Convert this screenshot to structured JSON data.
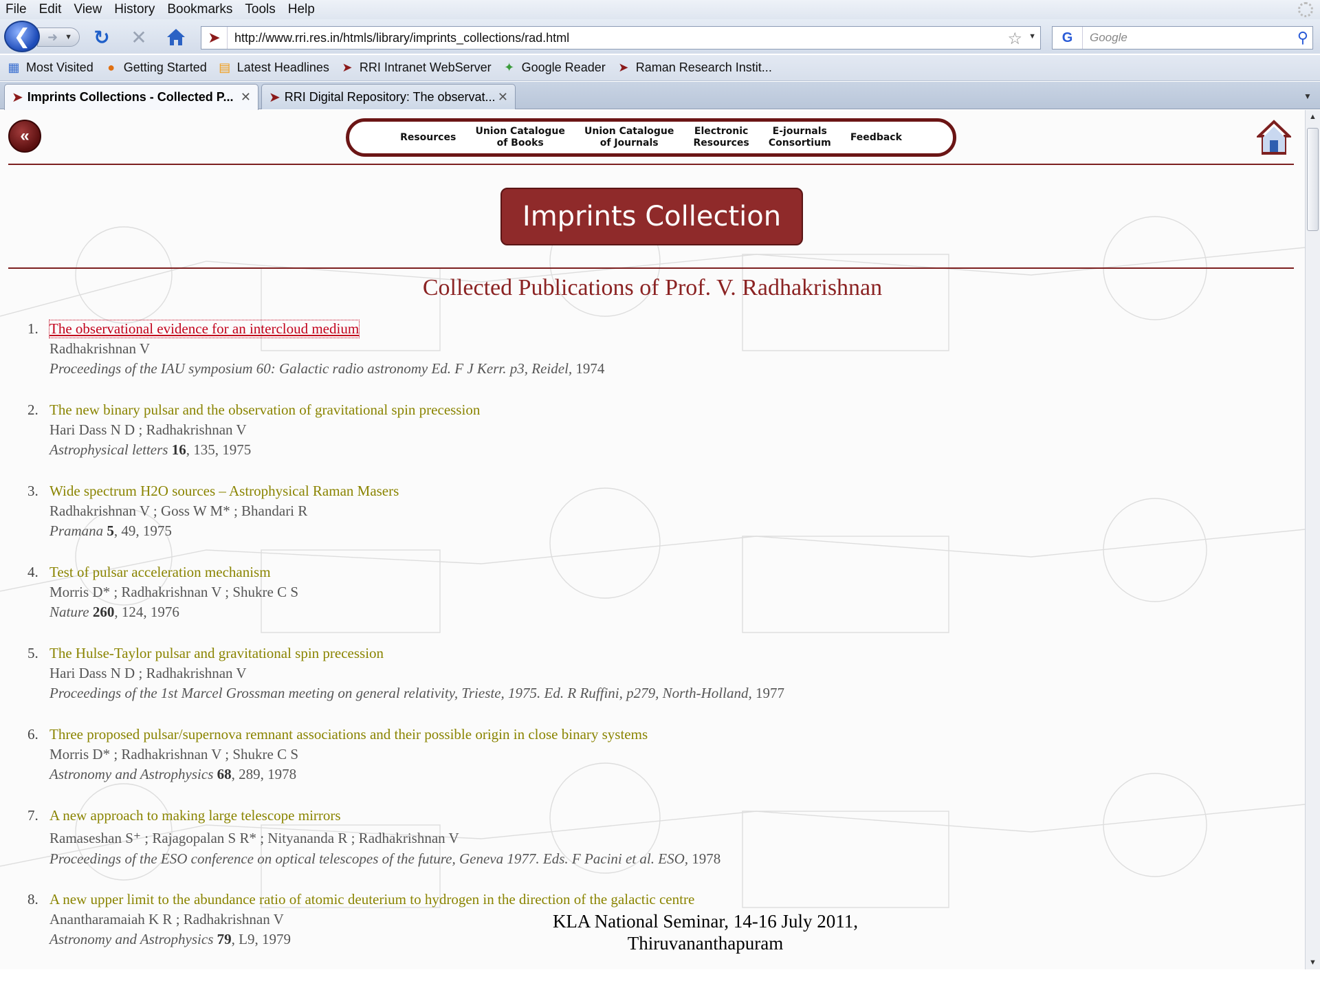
{
  "menubar": {
    "items": [
      "File",
      "Edit",
      "View",
      "History",
      "Bookmarks",
      "Tools",
      "Help"
    ]
  },
  "navbar": {
    "url": "http://www.rri.res.in/htmls/library/imprints_collections/rad.html",
    "search_placeholder": "Google"
  },
  "bookmarks": [
    {
      "label": "Most Visited",
      "icon": "most-visited-icon"
    },
    {
      "label": "Getting Started",
      "icon": "firefox-icon"
    },
    {
      "label": "Latest Headlines",
      "icon": "rss-icon"
    },
    {
      "label": "RRI Intranet WebServer",
      "icon": "rri-logo-icon"
    },
    {
      "label": "Google Reader",
      "icon": "google-reader-icon"
    },
    {
      "label": "Raman Research Instit...",
      "icon": "rri-logo-icon"
    }
  ],
  "tabs": [
    {
      "label": "Imprints Collections - Collected P...",
      "active": true
    },
    {
      "label": "RRI Digital Repository: The observat...",
      "active": false
    }
  ],
  "site_nav": {
    "resources": "Resources",
    "union_books_1": "Union Catalogue",
    "union_books_2": "of Books",
    "union_journals_1": "Union Catalogue",
    "union_journals_2": "of Journals",
    "electronic_1": "Electronic",
    "electronic_2": "Resources",
    "ejournals_1": "E-journals",
    "ejournals_2": "Consortium",
    "feedback": "Feedback"
  },
  "page": {
    "banner": "Imprints Collection",
    "heading": "Collected Publications of Prof. V. Radhakrishnan"
  },
  "publications": [
    {
      "num": "1.",
      "title": "The observational evidence for an intercloud medium",
      "authors": "Radhakrishnan V",
      "journal": "Proceedings of the IAU symposium 60: Galactic radio astronomy Ed. F J Kerr. p3, Reidel,",
      "volume": "",
      "rest": " 1974"
    },
    {
      "num": "2.",
      "title": "The new binary pulsar and the observation of gravitational spin precession",
      "authors": "Hari Dass N D ;   Radhakrishnan V",
      "journal": "Astrophysical letters",
      "volume": "16",
      "rest": ", 135, 1975"
    },
    {
      "num": "3.",
      "title": "Wide spectrum H2O sources – Astrophysical Raman Masers",
      "authors": "Radhakrishnan V ;   Goss W M* ;   Bhandari R",
      "journal": "Pramana",
      "volume": "5",
      "rest": ", 49, 1975"
    },
    {
      "num": "4.",
      "title": "Test of pulsar acceleration mechanism",
      "authors": "Morris D* ;   Radhakrishnan V ;   Shukre C S",
      "journal": "Nature",
      "volume": "260",
      "rest": ", 124, 1976"
    },
    {
      "num": "5.",
      "title": "The Hulse-Taylor pulsar and gravitational spin precession",
      "authors": "Hari Dass N D ;   Radhakrishnan V",
      "journal": "Proceedings of the 1st Marcel Grossman meeting on general relativity, Trieste, 1975. Ed. R Ruffini, p279, North-Holland,",
      "volume": "",
      "rest": " 1977"
    },
    {
      "num": "6.",
      "title": "Three proposed pulsar/supernova remnant associations and their possible origin in close binary systems",
      "authors": "Morris D* ;   Radhakrishnan V ;   Shukre C S",
      "journal": "Astronomy and Astrophysics",
      "volume": "68",
      "rest": ", 289, 1978"
    },
    {
      "num": "7.",
      "title": "A new approach to making large telescope mirrors",
      "authors": "Ramaseshan S⁺ ;   Rajagopalan S R* ;   Nityananda R ;   Radhakrishnan V",
      "journal": "Proceedings of the ESO conference on optical telescopes of the future, Geneva 1977. Eds. F Pacini et al. ESO,",
      "volume": "",
      "rest": " 1978"
    },
    {
      "num": "8.",
      "title": "A new upper limit to the abundance ratio of atomic deuterium to hydrogen in the direction of the galactic centre",
      "authors": "Anantharamaiah K R ;   Radhakrishnan V",
      "journal": "Astronomy and Astrophysics",
      "volume": "79",
      "rest": ", L9, 1979"
    }
  ],
  "footer": {
    "line1": "KLA National Seminar, 14-16 July 2011,",
    "line2": "Thiruvananthapuram"
  },
  "colors": {
    "brand": "#8b2323",
    "link": "#8a8400",
    "visited_link": "#c2001b"
  }
}
